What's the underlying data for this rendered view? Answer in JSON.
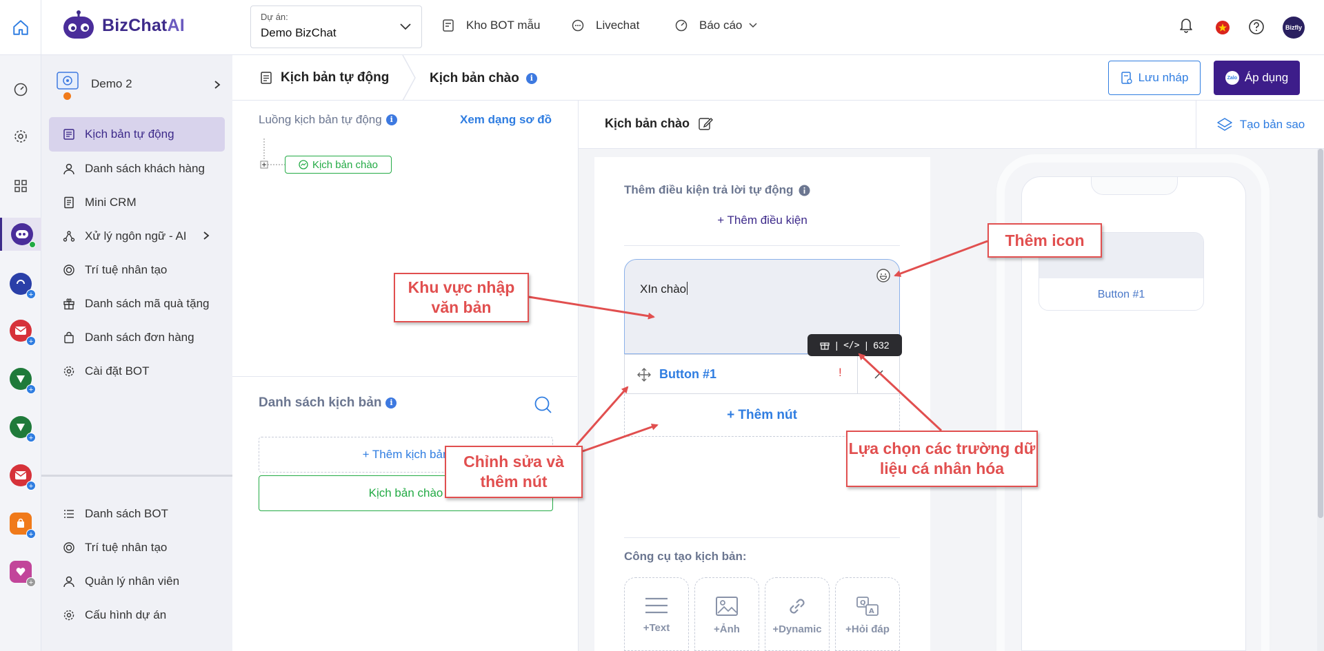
{
  "header": {
    "logo_main": "BizChat",
    "logo_accent": "AI",
    "project_label": "Dự án:",
    "project_value": "Demo BizChat",
    "nav": [
      {
        "label": "Kho BOT mẫu"
      },
      {
        "label": "Livechat"
      },
      {
        "label": "Báo cáo"
      }
    ],
    "avatar_text": "Bizfly"
  },
  "sidebar": {
    "bot_name": "Demo 2",
    "items": [
      {
        "label": "Kịch bản tự động"
      },
      {
        "label": "Danh sách khách hàng"
      },
      {
        "label": "Mini CRM"
      },
      {
        "label": "Xử lý ngôn ngữ - AI"
      },
      {
        "label": "Trí tuệ nhân tạo"
      },
      {
        "label": "Danh sách mã quà tặng"
      },
      {
        "label": "Danh sách đơn hàng"
      },
      {
        "label": "Cài đặt BOT"
      }
    ],
    "bottom_items": [
      {
        "label": "Danh sách BOT"
      },
      {
        "label": "Trí tuệ nhân tạo"
      },
      {
        "label": "Quản lý nhân viên"
      },
      {
        "label": "Cấu hình dự án"
      }
    ]
  },
  "subheader": {
    "crumb_root": "Kịch bản tự động",
    "crumb_current": "Kịch bản chào",
    "save_draft": "Lưu nháp",
    "apply": "Áp dụng",
    "apply_badge": "Zalo"
  },
  "flow": {
    "title": "Luồng kịch bản tự động",
    "view_diagram": "Xem dạng sơ đồ",
    "node": "Kịch bản chào",
    "list_title": "Danh sách kịch bản",
    "add_script": "+ Thêm kịch bản",
    "scripts": [
      {
        "label": "Kịch bản chào"
      }
    ]
  },
  "editor": {
    "title": "Kịch bản chào",
    "duplicate": "Tạo bản sao",
    "condition_title": "Thêm điều kiện trả lời tự động",
    "add_condition": "+ Thêm điều kiện",
    "message_text": "XIn chào",
    "char_count": "632",
    "button_label": "Button #1",
    "button_warning": "!",
    "add_button": "+ Thêm nút",
    "tools_title": "Công cụ tạo kịch bản:",
    "tools": [
      {
        "label": "+Text"
      },
      {
        "label": "+Ảnh"
      },
      {
        "label": "+Dynamic"
      },
      {
        "label": "+Hỏi đáp"
      }
    ]
  },
  "preview": {
    "button_label": "Button #1"
  },
  "annotations": {
    "text_area": "Khu vực nhập văn bản",
    "add_icon": "Thêm icon",
    "edit_buttons": "Chỉnh sửa và thêm nút",
    "personalize": "Lựa chọn các trường dữ liệu cá nhân hóa"
  },
  "colors": {
    "brand": "#3d1d8a",
    "accent": "#2f7de1",
    "success": "#22aa44",
    "annotation": "#e14f4f",
    "active_item_bg": "#d8d3ec"
  }
}
